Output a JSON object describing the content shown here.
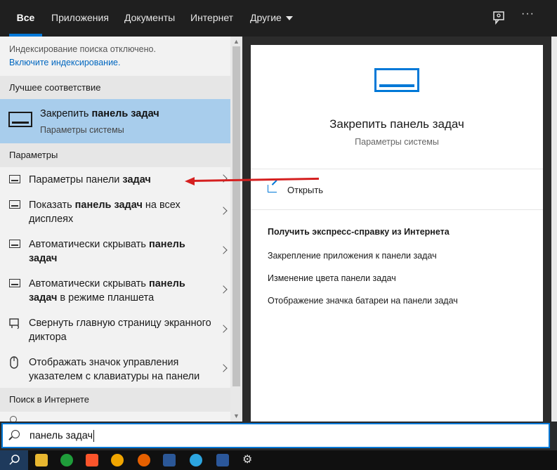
{
  "nav": {
    "tabs": [
      {
        "label": "Все",
        "active": true
      },
      {
        "label": "Приложения"
      },
      {
        "label": "Документы"
      },
      {
        "label": "Интернет"
      },
      {
        "label": "Другие"
      }
    ],
    "icons": [
      "feedback-icon",
      "more-icon"
    ],
    "more_label": "···"
  },
  "left": {
    "indexing_note": "Индексирование поиска отключено.",
    "indexing_link": "Включите индексирование.",
    "best_match_header": "Лучшее соответствие",
    "best_match": {
      "title_plain": "Закрепить ",
      "title_bold": "панель задач",
      "subtitle": "Параметры системы"
    },
    "settings_header": "Параметры",
    "items": [
      {
        "parts": [
          {
            "t": "Параметры панели "
          },
          {
            "t": "задач",
            "b": true
          }
        ]
      },
      {
        "parts": [
          {
            "t": "Показать "
          },
          {
            "t": "панель задач",
            "b": true
          },
          {
            "t": " на всех дисплеях"
          }
        ]
      },
      {
        "parts": [
          {
            "t": "Автоматически скрывать "
          },
          {
            "t": "панель задач",
            "b": true
          }
        ]
      },
      {
        "parts": [
          {
            "t": "Автоматически скрывать "
          },
          {
            "t": "панель задач",
            "b": true
          },
          {
            "t": " в режиме планшета"
          }
        ]
      },
      {
        "parts": [
          {
            "t": "Свернуть главную страницу экранного диктора"
          }
        ]
      },
      {
        "parts": [
          {
            "t": "Отображать значок управления указателем с клавиатуры на панели"
          }
        ]
      }
    ],
    "web_header": "Поиск в Интернете"
  },
  "search": {
    "value": "панель задач"
  },
  "right": {
    "title": "Закрепить панель задач",
    "subtitle": "Параметры системы",
    "open_label": "Открыть",
    "help_header": "Получить экспресс-справку из Интернета",
    "help_links": [
      "Закрепление приложения к панели задач",
      "Изменение цвета панели задач",
      "Отображение значка батареи на панели задач"
    ]
  },
  "colors": {
    "accent": "#0078d7",
    "selected": "#a8cdec",
    "arrow": "#d52020"
  }
}
